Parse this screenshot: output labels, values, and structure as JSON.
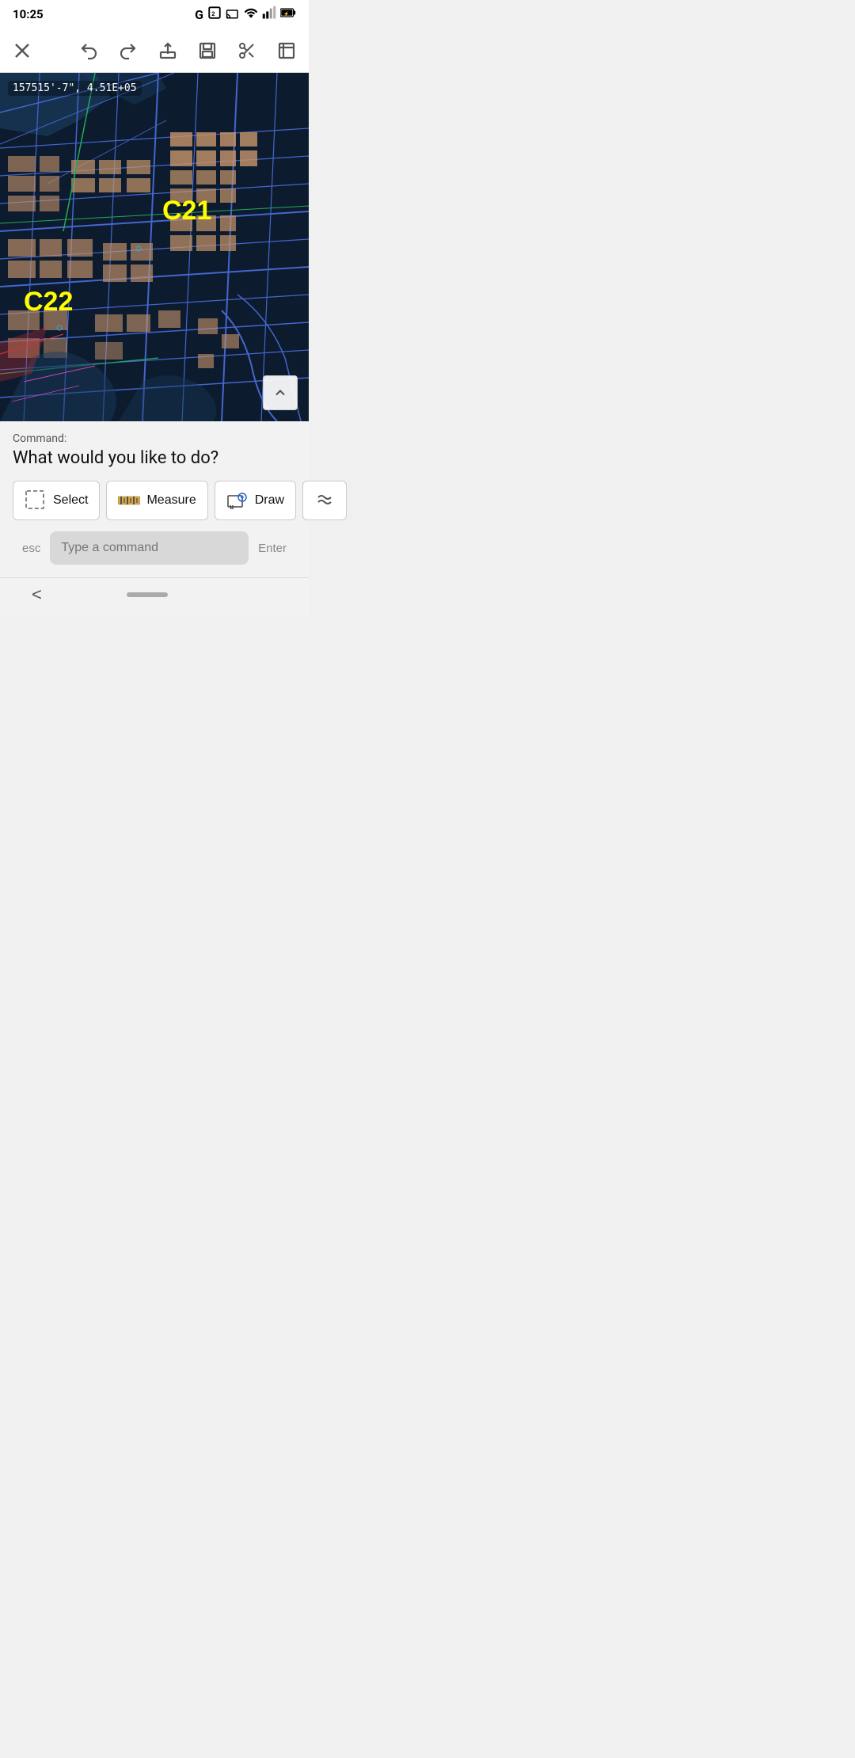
{
  "statusBar": {
    "time": "10:25",
    "icons": [
      "G",
      "2",
      "cast",
      "wifi",
      "signal",
      "battery"
    ]
  },
  "toolbar": {
    "closeLabel": "×",
    "undoLabel": "undo",
    "redoLabel": "redo",
    "shareLabel": "share",
    "saveLabel": "save",
    "cursorLabel": "cursor-scissors",
    "expandLabel": "expand"
  },
  "map": {
    "coordinates": "157515'-7\", 4.51E+05",
    "labelC21": "C21",
    "labelC22": "C22",
    "expandIcon": "chevron-up"
  },
  "commandArea": {
    "commandLabel": "Command:",
    "questionText": "What would you like to do?",
    "buttons": [
      {
        "id": "select",
        "label": "Select",
        "icon": "select-icon"
      },
      {
        "id": "measure",
        "label": "Measure",
        "icon": "measure-icon"
      },
      {
        "id": "draw",
        "label": "Draw",
        "icon": "draw-icon"
      },
      {
        "id": "more",
        "label": "…",
        "icon": "more-icon"
      }
    ],
    "input": {
      "placeholder": "Type a command",
      "escLabel": "esc",
      "enterLabel": "Enter"
    }
  },
  "bottomNav": {
    "backLabel": "<"
  }
}
